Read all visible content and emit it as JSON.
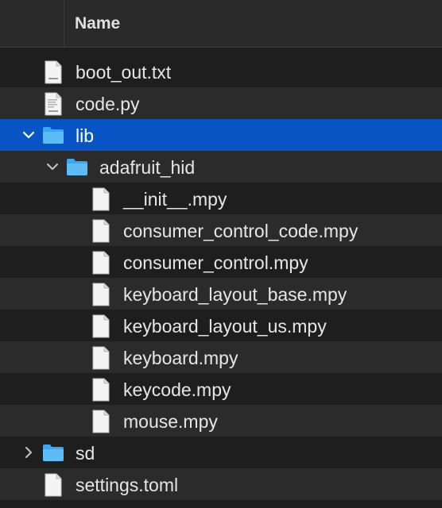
{
  "header": {
    "name_label": "Name"
  },
  "items": [
    {
      "label": "boot_out.txt",
      "icon": "text-file-icon"
    },
    {
      "label": "code.py",
      "icon": "python-file-icon"
    },
    {
      "label": "lib",
      "icon": "folder-icon",
      "state": "expanded",
      "selected": true
    },
    {
      "label": "adafruit_hid",
      "icon": "folder-icon",
      "state": "expanded"
    },
    {
      "label": "__init__.mpy",
      "icon": "document-icon"
    },
    {
      "label": "consumer_control_code.mpy",
      "icon": "document-icon"
    },
    {
      "label": "consumer_control.mpy",
      "icon": "document-icon"
    },
    {
      "label": "keyboard_layout_base.mpy",
      "icon": "document-icon"
    },
    {
      "label": "keyboard_layout_us.mpy",
      "icon": "document-icon"
    },
    {
      "label": "keyboard.mpy",
      "icon": "document-icon"
    },
    {
      "label": "keycode.mpy",
      "icon": "document-icon"
    },
    {
      "label": "mouse.mpy",
      "icon": "document-icon"
    },
    {
      "label": "sd",
      "icon": "folder-icon",
      "state": "collapsed"
    },
    {
      "label": "settings.toml",
      "icon": "document-icon"
    }
  ],
  "colors": {
    "selection": "#0a55c6",
    "folder": "#3aa8f0",
    "background": "#1e1e1e",
    "alt_row": "#2b2b2b"
  }
}
